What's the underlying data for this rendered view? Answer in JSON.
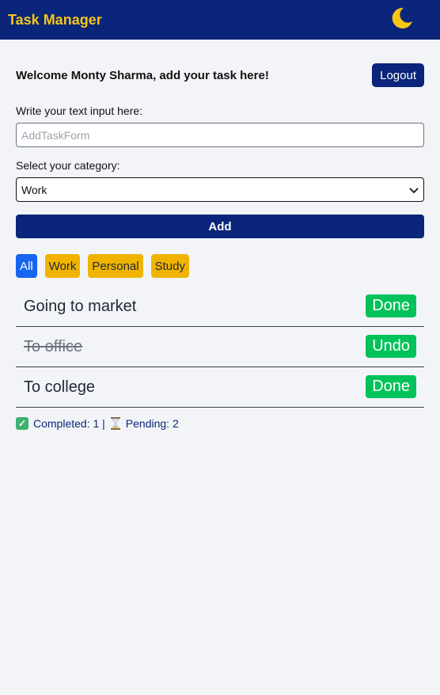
{
  "header": {
    "app_title": "Task Manager",
    "theme_icon": "moon-icon",
    "accent_color": "#f5c518",
    "bar_color": "#0a2579"
  },
  "welcome": {
    "message": "Welcome Monty Sharma, add your task here!",
    "logout_label": "Logout"
  },
  "form": {
    "text_label": "Write your text input here:",
    "text_placeholder": "AddTaskForm",
    "text_value": "",
    "category_label": "Select your category:",
    "category_value": "Work",
    "add_label": "Add"
  },
  "filters": [
    {
      "label": "All",
      "active": true
    },
    {
      "label": "Work",
      "active": false
    },
    {
      "label": "Personal",
      "active": false
    },
    {
      "label": "Study",
      "active": false
    }
  ],
  "tasks": [
    {
      "text": "Going to market",
      "completed": false,
      "action_label": "Done"
    },
    {
      "text": "To office",
      "completed": true,
      "action_label": "Undo"
    },
    {
      "text": "To college",
      "completed": false,
      "action_label": "Done"
    }
  ],
  "summary": {
    "completed_text": "Completed: 1 |",
    "pending_text": "Pending: 2"
  }
}
